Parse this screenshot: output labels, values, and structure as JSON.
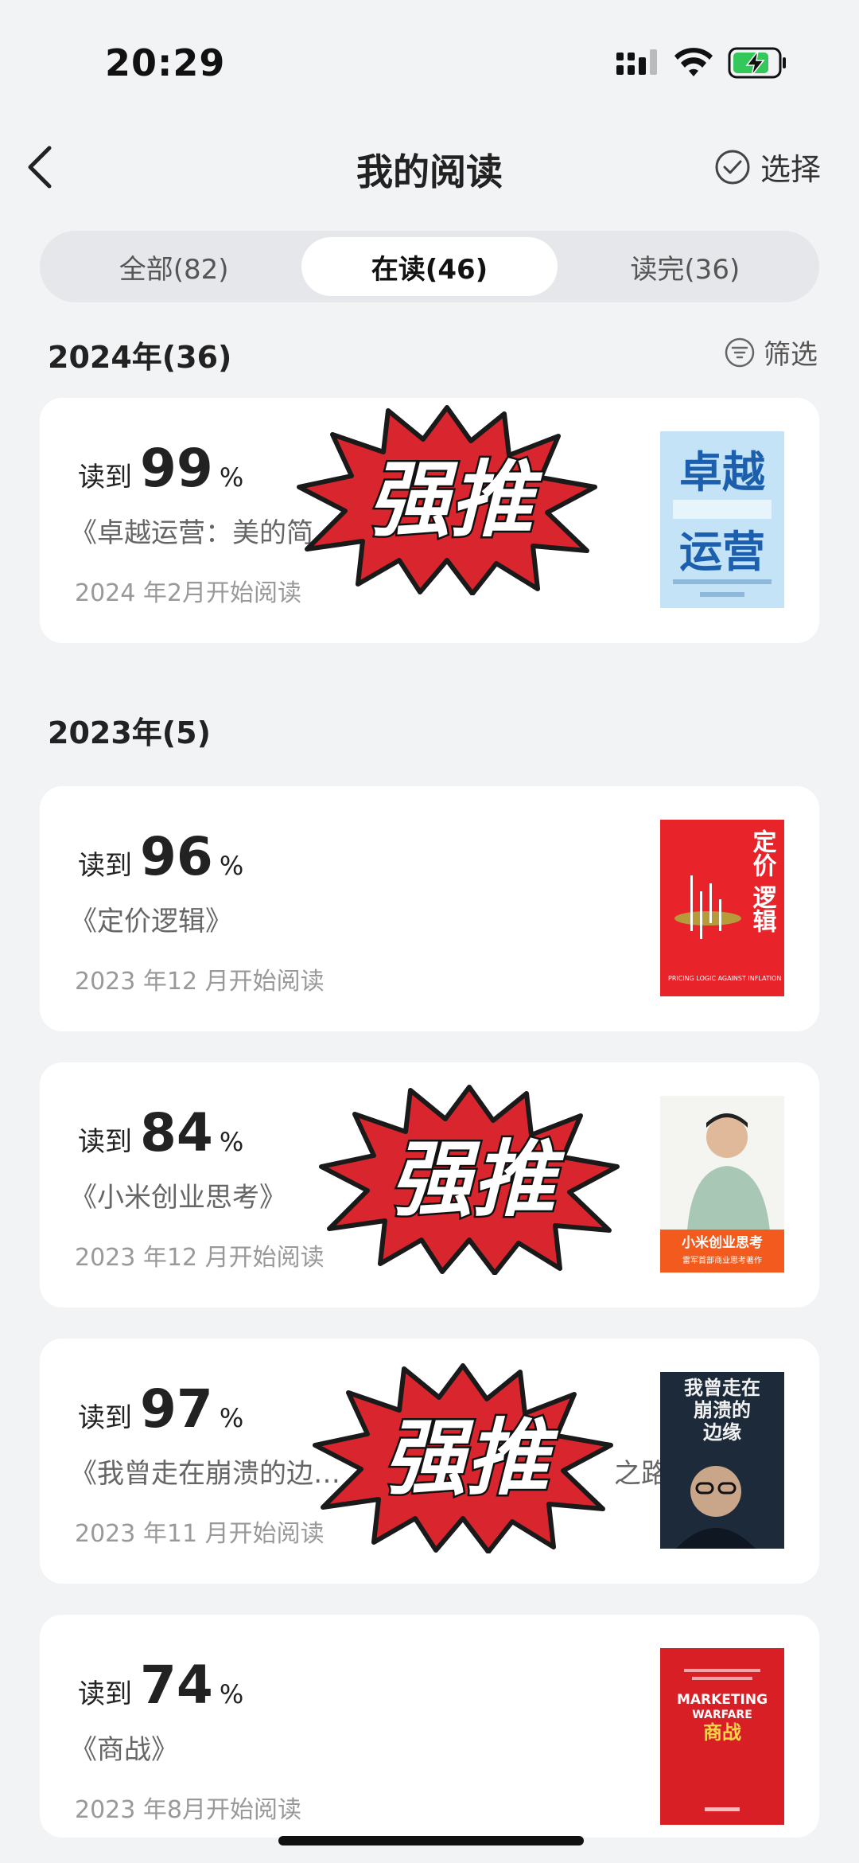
{
  "status_bar": {
    "time": "20:29"
  },
  "nav": {
    "title": "我的阅读",
    "select_label": "选择"
  },
  "tabs": [
    {
      "label": "全部(82)",
      "active": false
    },
    {
      "label": "在读(46)",
      "active": true
    },
    {
      "label": "读完(36)",
      "active": false
    }
  ],
  "filter_label": "筛选",
  "stamp_text": "强推",
  "sections": [
    {
      "header": "2024年(36)"
    },
    {
      "header": "2023年(5)"
    }
  ],
  "progress_prefix": "读到",
  "progress_suffix": "%",
  "books": [
    {
      "progress": "99",
      "title": "《卓越运营：美的简",
      "start": "2024 年2月开始阅读",
      "stamped": true,
      "cover": {
        "main": "卓越运营",
        "line1": "卓越",
        "line2": "运营",
        "color": "#bfe0f5"
      }
    },
    {
      "progress": "96",
      "title": "《定价逻辑》",
      "start": "2023 年12 月开始阅读",
      "stamped": false,
      "cover": {
        "main": "定价逻辑",
        "line1": "定价",
        "line2": "逻辑",
        "sub": "PRICING LOGIC AGAINST INFLATION",
        "color": "#e8232a"
      }
    },
    {
      "progress": "84",
      "title": "《小米创业思考》",
      "start": "2023 年12 月开始阅读",
      "stamped": true,
      "cover": {
        "main": "小米创业思考",
        "sub": "雷军首部商业思考著作",
        "color": "#f4f4f1"
      }
    },
    {
      "progress": "97",
      "title": "《我曾走在崩溃的边…",
      "title_tail": "之路》",
      "start": "2023 年11 月开始阅读",
      "stamped": true,
      "cover": {
        "main": "我曾走在崩溃的边缘",
        "line1": "我曾走在",
        "line2": "崩溃的",
        "line3": "边缘",
        "color": "#1c2a3a"
      }
    },
    {
      "progress": "74",
      "title": "《商战》",
      "start": "2023 年8月开始阅读",
      "stamped": false,
      "cover": {
        "main": "商战",
        "line1": "MARKETING",
        "line2": "WARFARE",
        "color": "#d91f26"
      }
    }
  ]
}
